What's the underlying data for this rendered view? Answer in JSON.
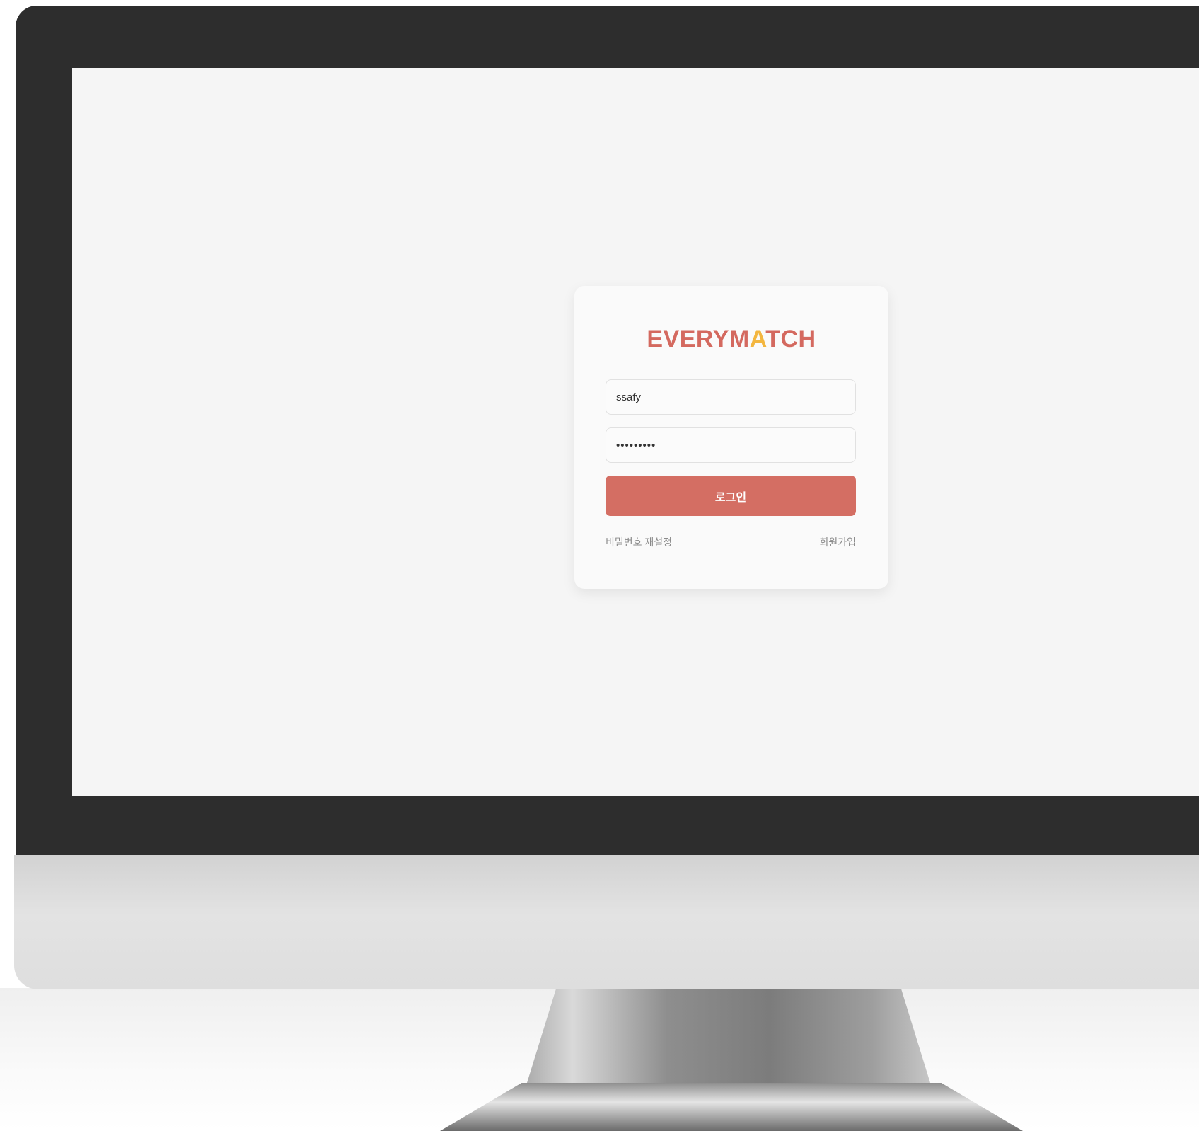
{
  "app": {
    "logo": {
      "part1": "EVERYM",
      "accent": "A",
      "part2": "TCH"
    }
  },
  "login_form": {
    "username_value": "ssafy",
    "password_value": "•••••••••",
    "submit_label": "로그인",
    "reset_password_label": "비밀번호 재설정",
    "signup_label": "회원가입"
  },
  "colors": {
    "brand": "#d4695f",
    "brand_accent": "#f3b63f",
    "button": "#d46e63"
  }
}
